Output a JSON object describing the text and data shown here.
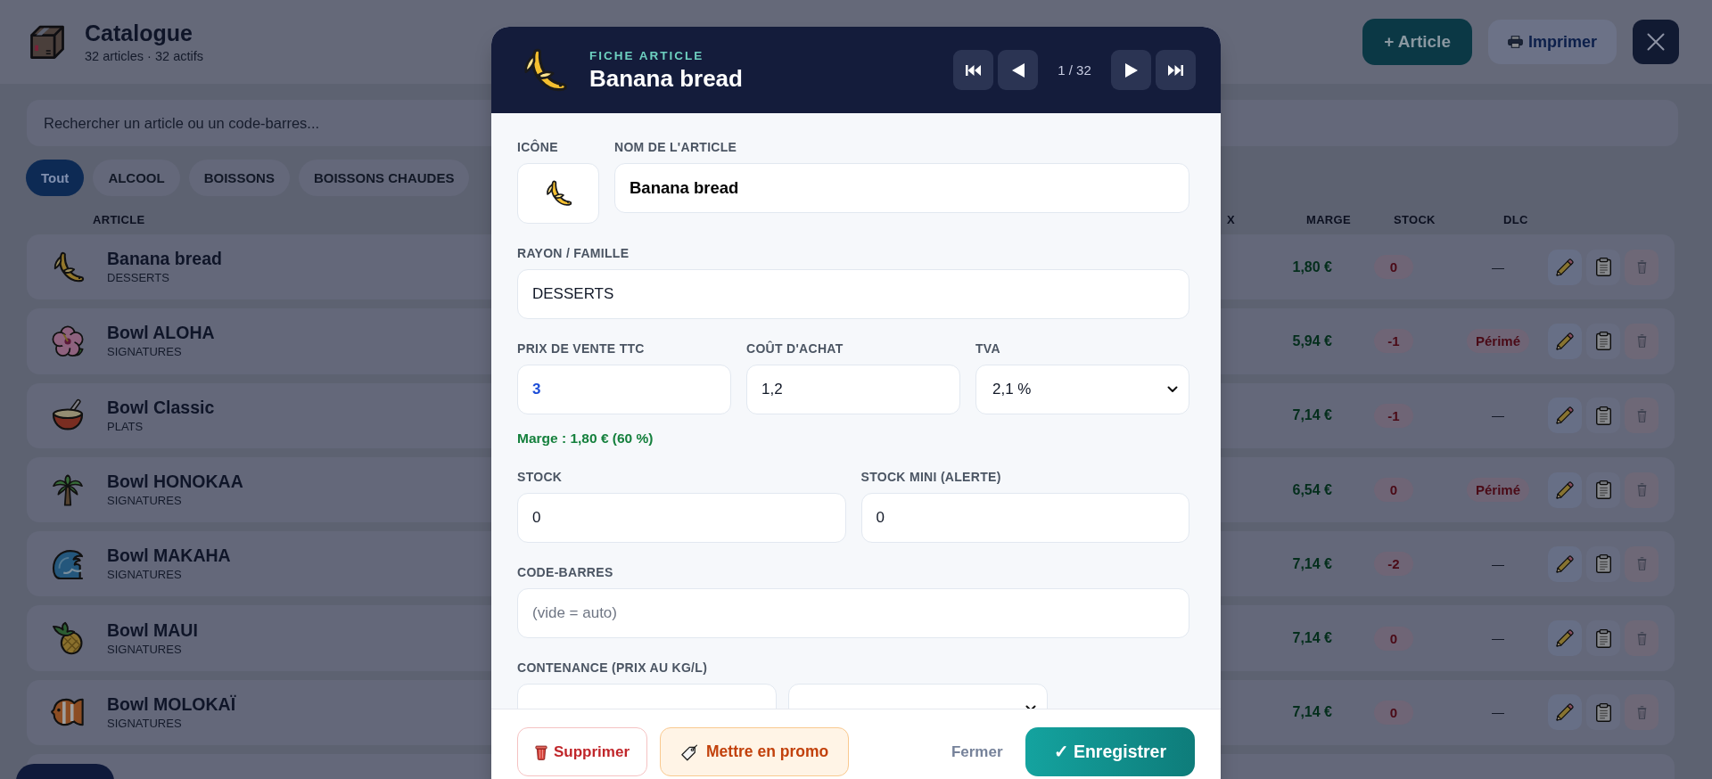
{
  "header": {
    "title": "Catalogue",
    "subtitle": "32 articles · 32 actifs",
    "buttons": [
      {
        "kind": "add",
        "label": "+ Article"
      },
      {
        "kind": "print",
        "label": "Imprimer"
      },
      {
        "kind": "close"
      }
    ]
  },
  "search": {
    "placeholder": "Rechercher un article ou un code-barres..."
  },
  "filters": [
    {
      "label": "Tout",
      "selected": true
    },
    {
      "label": "ALCOOL",
      "selected": false
    },
    {
      "label": "BOISSONS",
      "selected": false
    },
    {
      "label": "BOISSONS CHAUDES",
      "selected": false
    }
  ],
  "table": {
    "columns": [
      "ARTICLE",
      "X",
      "MARGE",
      "STOCK",
      "DLC"
    ],
    "rows": [
      {
        "kind": "banana",
        "name": "Banana bread",
        "category": "DESSERTS",
        "margin": "1,80 €",
        "stock": "0",
        "stock_alert": true,
        "dlc": "—",
        "expired": false
      },
      {
        "kind": "hibiscus",
        "name": "Bowl ALOHA",
        "category": "SIGNATURES",
        "margin": "5,94 €",
        "stock": "-1",
        "stock_alert": true,
        "dlc": "Périmé",
        "expired": true
      },
      {
        "kind": "bowl",
        "name": "Bowl Classic",
        "category": "PLATS",
        "margin": "7,14 €",
        "stock": "-1",
        "stock_alert": true,
        "dlc": "—",
        "expired": false
      },
      {
        "kind": "palm-tree",
        "name": "Bowl HONOKAA",
        "category": "SIGNATURES",
        "margin": "6,54 €",
        "stock": "0",
        "stock_alert": true,
        "dlc": "Périmé",
        "expired": true
      },
      {
        "kind": "wave",
        "name": "Bowl MAKAHA",
        "category": "SIGNATURES",
        "margin": "7,14 €",
        "stock": "-2",
        "stock_alert": true,
        "dlc": "—",
        "expired": false
      },
      {
        "kind": "pineapple",
        "name": "Bowl MAUI",
        "category": "SIGNATURES",
        "margin": "7,14 €",
        "stock": "0",
        "stock_alert": true,
        "dlc": "—",
        "expired": false
      },
      {
        "kind": "fish",
        "name": "Bowl MOLOKAÏ",
        "category": "SIGNATURES",
        "margin": "7,14 €",
        "stock": "0",
        "stock_alert": true,
        "dlc": "—",
        "expired": false
      }
    ]
  },
  "modal": {
    "kind": "banana",
    "eyebrow": "FICHE ARTICLE",
    "title": "Banana bread",
    "pager": "1 / 32",
    "form": [
      {
        "fields": [
          {
            "kind": "icon",
            "label": "ICÔNE"
          },
          {
            "kind": "name",
            "label": "NOM DE L'ARTICLE",
            "value": "Banana bread"
          }
        ]
      },
      {
        "fields": [
          {
            "kind": "input",
            "label": "RAYON / FAMILLE",
            "value": "DESSERTS"
          }
        ]
      },
      {
        "fields": [
          {
            "kind": "price",
            "label": "PRIX DE VENTE TTC",
            "value": "3"
          },
          {
            "kind": "input",
            "label": "COÛT D'ACHAT",
            "value": "1,2"
          },
          {
            "kind": "select",
            "label": "TVA",
            "value": "2,1 %"
          }
        ]
      },
      {
        "note": "Marge : 1,80 € (60 %)"
      },
      {
        "fields": [
          {
            "kind": "input",
            "label": "STOCK",
            "value": "0"
          },
          {
            "kind": "input",
            "label": "STOCK MINI (ALERTE)",
            "value": "0"
          }
        ]
      },
      {
        "fields": [
          {
            "kind": "input",
            "label": "CODE-BARRES",
            "placeholder": "(vide = auto)"
          }
        ]
      },
      {
        "label": "CONTENANCE (PRIX AU KG/L)",
        "fields": [
          {
            "kind": "input"
          },
          {
            "kind": "select"
          }
        ]
      }
    ],
    "footer": [
      {
        "kind": "delete",
        "label": "Supprimer"
      },
      {
        "kind": "promo",
        "label": "Mettre en promo"
      },
      {
        "kind": "close",
        "label": "Fermer"
      },
      {
        "kind": "save",
        "label": "✓ Enregistrer"
      }
    ]
  }
}
